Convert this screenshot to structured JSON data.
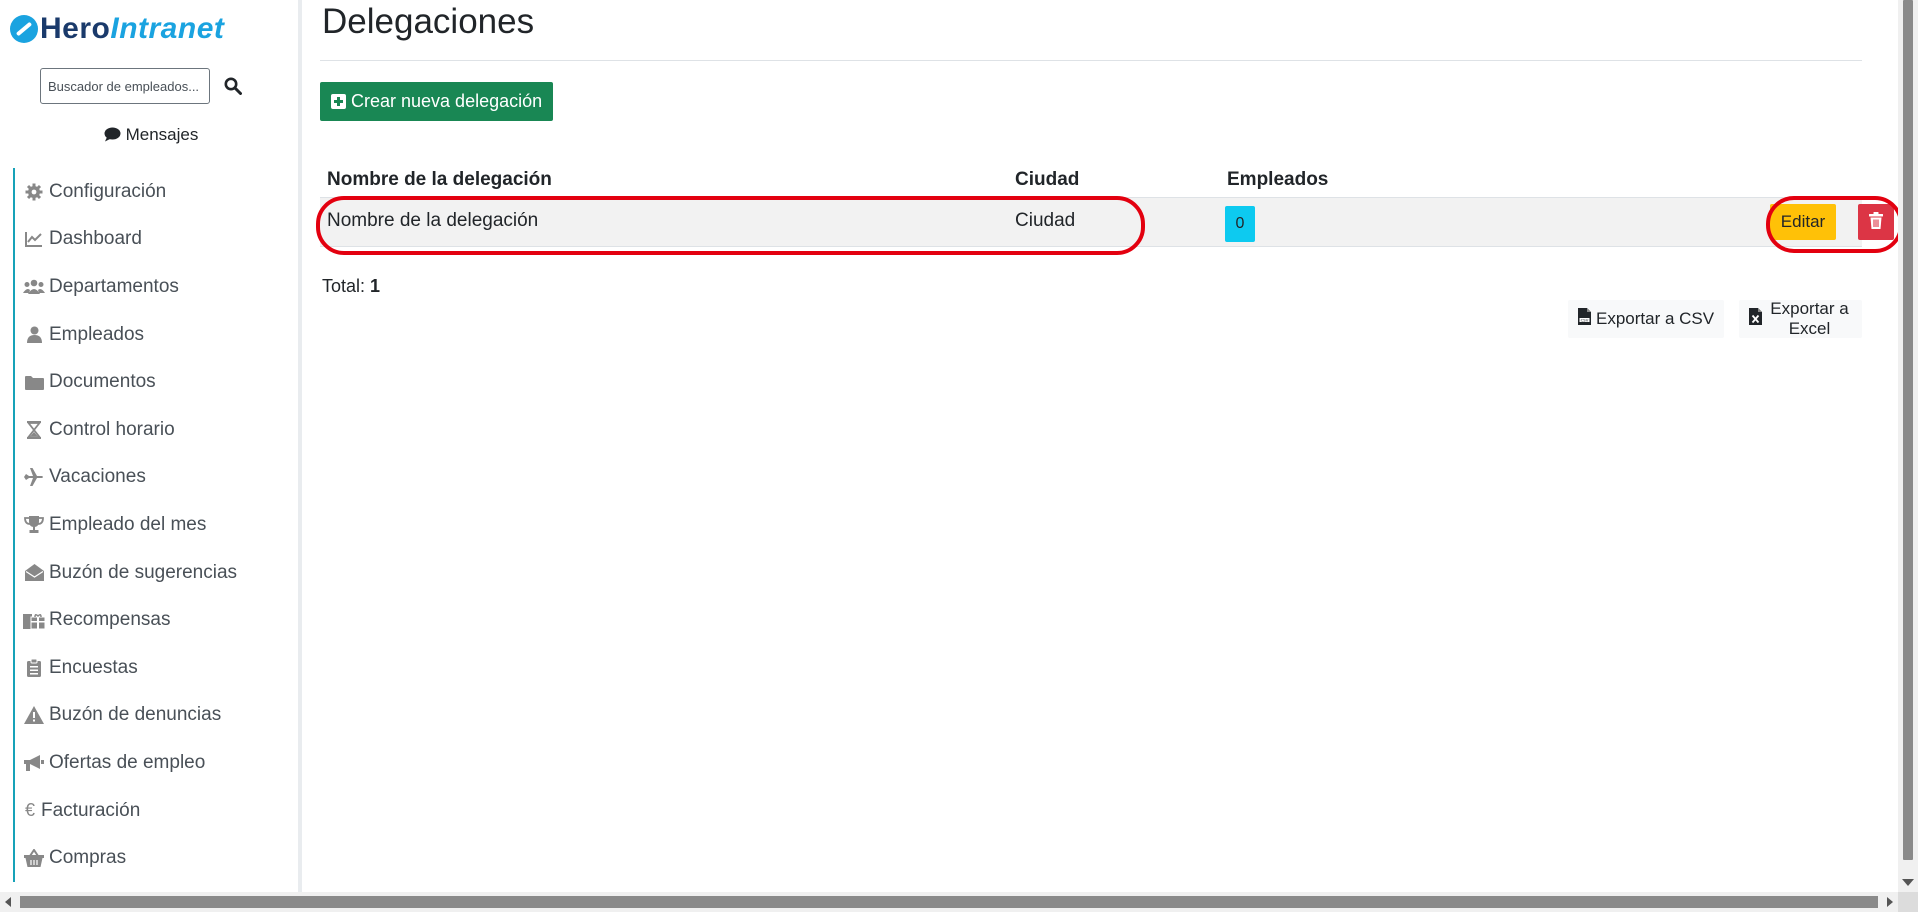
{
  "brand": {
    "hero": "Hero",
    "intranet": "Intranet",
    "accent": "#1aa3e0",
    "dark": "#1a3a6b"
  },
  "search": {
    "placeholder": "Buscador de empleados..."
  },
  "messages": {
    "label": "Mensajes"
  },
  "sidebar": {
    "items": [
      {
        "label": "Configuración",
        "icon": "gear-icon"
      },
      {
        "label": "Dashboard",
        "icon": "chart-line-icon"
      },
      {
        "label": "Departamentos",
        "icon": "users-icon"
      },
      {
        "label": "Empleados",
        "icon": "user-icon"
      },
      {
        "label": "Documentos",
        "icon": "folder-icon"
      },
      {
        "label": "Control horario",
        "icon": "hourglass-icon"
      },
      {
        "label": "Vacaciones",
        "icon": "plane-icon"
      },
      {
        "label": "Empleado del mes",
        "icon": "trophy-icon"
      },
      {
        "label": "Buzón de sugerencias",
        "icon": "envelope-open-icon"
      },
      {
        "label": "Recompensas",
        "icon": "gifts-icon"
      },
      {
        "label": "Encuestas",
        "icon": "clipboard-icon"
      },
      {
        "label": "Buzón de denuncias",
        "icon": "warning-icon"
      },
      {
        "label": "Ofertas de empleo",
        "icon": "megaphone-icon"
      },
      {
        "label": "Facturación",
        "icon": "euro-icon"
      },
      {
        "label": "Compras",
        "icon": "basket-icon"
      }
    ]
  },
  "page": {
    "title": "Delegaciones",
    "create_label": "Crear nueva delegación"
  },
  "table": {
    "headers": {
      "name": "Nombre de la delegación",
      "city": "Ciudad",
      "employees": "Empleados"
    },
    "rows": [
      {
        "name": "Nombre de la delegación",
        "city": "Ciudad",
        "employees": "0",
        "edit_label": "Editar"
      }
    ]
  },
  "total": {
    "label": "Total:",
    "value": "1"
  },
  "export": {
    "csv_label": "Exportar a CSV",
    "excel_label": "Exportar a Excel"
  },
  "colors": {
    "create": "#198754",
    "badge": "#0dcaf0",
    "edit": "#ffc107",
    "delete": "#dc3545",
    "highlight": "#e3000f",
    "nav_accent": "#17a2b8"
  }
}
